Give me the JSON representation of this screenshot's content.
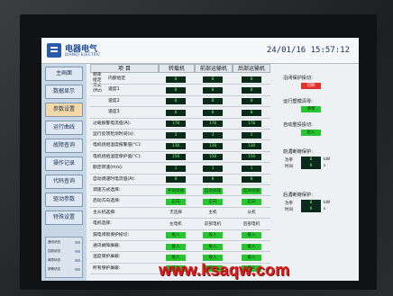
{
  "header": {
    "brand": "电器电气",
    "brand_sub": "DIANQI ELECTRIC",
    "datetime": "24/01/16 15:57:12"
  },
  "sidebar": {
    "items": [
      {
        "label": "主画面"
      },
      {
        "label": "数据显示"
      },
      {
        "label": "参数设置"
      },
      {
        "label": "运行曲线"
      },
      {
        "label": "故障查询"
      },
      {
        "label": "操作记录"
      },
      {
        "label": "代码查询"
      },
      {
        "label": "驱动参数"
      },
      {
        "label": "特殊设置"
      }
    ],
    "panel_rows": [
      "通讯状态",
      "控制状态",
      "故障状态",
      "报警状态"
    ]
  },
  "table": {
    "headers": [
      "项  目",
      "转载机",
      "前部运输机",
      "后部运输机"
    ],
    "group_label": "频率给定方式(Hz)",
    "rows": [
      {
        "label": "内部给定",
        "values": [
          "0",
          "0",
          "0"
        ],
        "style": "dark"
      },
      {
        "label": "速度1",
        "values": [
          "0",
          "0",
          "0"
        ],
        "style": "dark"
      },
      {
        "label": "速度2",
        "values": [
          "0",
          "0",
          "0"
        ],
        "style": "dark"
      },
      {
        "label": "速度3",
        "values": [
          "0",
          "0",
          "0"
        ],
        "style": "dark"
      },
      {
        "label": "过载报警电流值(A):",
        "values": [
          "170",
          "170",
          "170"
        ],
        "style": "dark"
      },
      {
        "label": "运行反馈检测时间(s):",
        "values": [
          "3",
          "3",
          "3"
        ],
        "style": "dark"
      },
      {
        "label": "电机绕组温度报警值(℃):",
        "values": [
          "130",
          "130",
          "130"
        ],
        "style": "dark"
      },
      {
        "label": "电机绕组温度保护值(℃):",
        "values": [
          "150",
          "150",
          "150"
        ],
        "style": "dark"
      },
      {
        "label": "额定转速(m/s):",
        "values": [
          "1",
          "1",
          "1"
        ],
        "style": "dark"
      },
      {
        "label": "自动调速时电流值(A):",
        "values": [
          "0",
          "0",
          "0"
        ],
        "style": "dark"
      },
      {
        "label": "调速方式选择:",
        "values": [
          "手动调速",
          "自动调速",
          "自动调速"
        ],
        "style": "green"
      },
      {
        "label": "启动方向选择:",
        "values": [
          "正向",
          "正向",
          "正向"
        ],
        "style": "green"
      },
      {
        "label": "主从机选择:",
        "values": [
          "无选择",
          "主机",
          "从机"
        ],
        "style": "plain"
      },
      {
        "label": "电机选择:",
        "values": [
          "左电机",
          "前部电机",
          "后部电机"
        ],
        "style": "plain"
      },
      {
        "label": "漏电闭锁保护投切:",
        "values": [
          "投入",
          "投入",
          "投入"
        ],
        "style": "green"
      },
      {
        "label": "通讯故障屏蔽:",
        "values": [
          "投入",
          "投入",
          "投入"
        ],
        "style": "green"
      },
      {
        "label": "温度保护屏蔽:",
        "values": [
          "投入",
          "投入",
          "投入"
        ],
        "style": "green"
      },
      {
        "label": "所有保护屏蔽:",
        "values": [
          "投入",
          "投入",
          "投入"
        ],
        "style": "green"
      }
    ]
  },
  "right_panel": {
    "items": [
      {
        "label": "沿闭保护投切:",
        "button": "切除",
        "color": "red"
      },
      {
        "label": "运行塑模清零:",
        "button": "清零",
        "color": "green"
      },
      {
        "label": "自动重投投切:",
        "button": "投入",
        "color": "green"
      },
      {
        "label": "前湄断链保护:",
        "value_label": "功率",
        "value": "0",
        "unit": "kW"
      },
      {
        "label": "",
        "value_label": "时间",
        "value": "0",
        "unit": "s"
      },
      {
        "label": "后湄断链保护:",
        "value_label": "功率",
        "value": "0",
        "unit": "kW"
      },
      {
        "label": "",
        "value_label": "时间",
        "value": "0",
        "unit": "s"
      }
    ]
  },
  "watermark": "www.ksaqw.com"
}
